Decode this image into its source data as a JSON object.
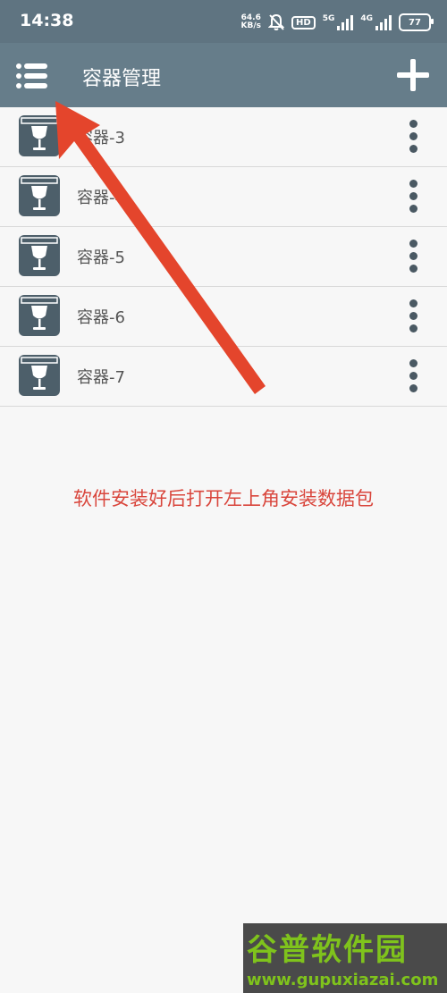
{
  "status_bar": {
    "time": "14:38",
    "net_speed_value": "64.6",
    "net_speed_unit": "KB/s",
    "hd_badge": "HD",
    "signal_1_label": "5G",
    "signal_2_label": "4G",
    "battery": "77"
  },
  "app_bar": {
    "title": "容器管理",
    "menu_icon": "menu-icon",
    "add_icon": "plus-icon"
  },
  "containers": [
    {
      "label": "容器-3"
    },
    {
      "label": "容器-4"
    },
    {
      "label": "容器-5"
    },
    {
      "label": "容器-6"
    },
    {
      "label": "容器-7"
    }
  ],
  "hint_text": "软件安装好后打开左上角安装数据包",
  "annotation_color": "#e4452c",
  "watermark": {
    "title": "谷普软件园",
    "url": "www.gupuxiazai.com"
  }
}
